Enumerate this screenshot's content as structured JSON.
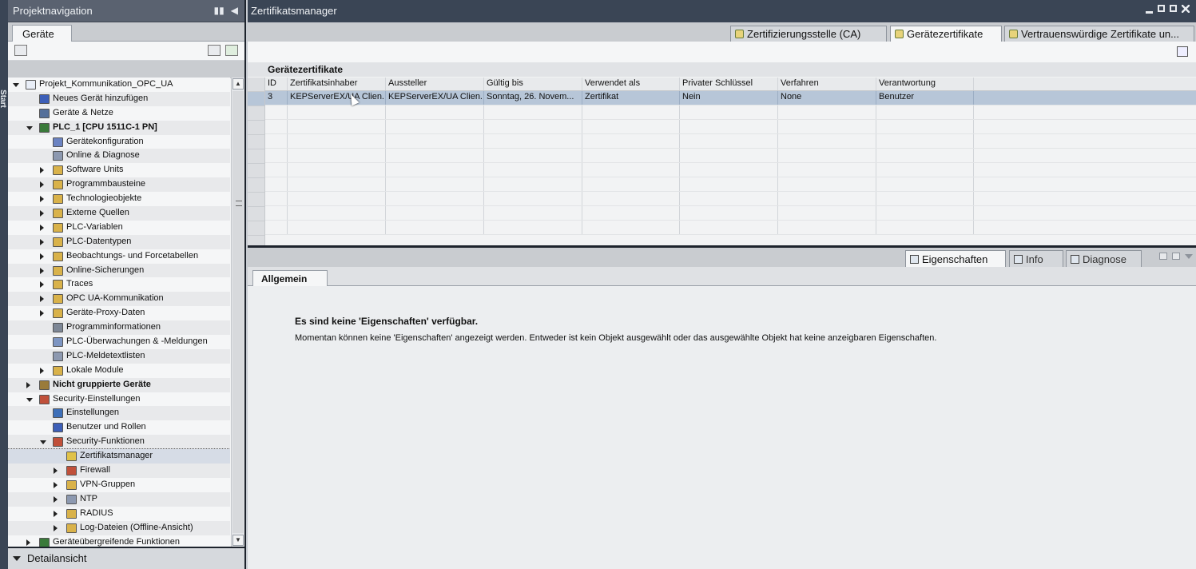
{
  "left_strip": {
    "label": "Start"
  },
  "nav": {
    "title": "Projektnavigation",
    "tab": "Geräte",
    "detail": "Detailansicht"
  },
  "tree": [
    {
      "label": "Projekt_Kommunikation_OPC_UA",
      "indent": 0,
      "arrow": "down",
      "icon": "project-icon",
      "color": "#e9eef7",
      "bold": false
    },
    {
      "label": "Neues Gerät hinzufügen",
      "indent": 1,
      "arrow": "",
      "icon": "add-device-icon",
      "color": "#3d5fb8",
      "bold": false
    },
    {
      "label": "Geräte & Netze",
      "indent": 1,
      "arrow": "",
      "icon": "network-icon",
      "color": "#55709a",
      "bold": false
    },
    {
      "label": "PLC_1 [CPU 1511C-1 PN]",
      "indent": 1,
      "arrow": "down",
      "icon": "plc-icon",
      "color": "#3a7a3a",
      "bold": true
    },
    {
      "label": "Gerätekonfiguration",
      "indent": 2,
      "arrow": "",
      "icon": "device-config-icon",
      "color": "#6b83c2",
      "bold": false
    },
    {
      "label": "Online & Diagnose",
      "indent": 2,
      "arrow": "",
      "icon": "diagnose-icon",
      "color": "#8d99b0",
      "bold": false
    },
    {
      "label": "Software Units",
      "indent": 2,
      "arrow": "right",
      "icon": "software-units-icon",
      "color": "#d9b24a",
      "bold": false
    },
    {
      "label": "Programmbausteine",
      "indent": 2,
      "arrow": "right",
      "icon": "folder-icon",
      "color": "#d9b24a",
      "bold": false
    },
    {
      "label": "Technologieobjekte",
      "indent": 2,
      "arrow": "right",
      "icon": "technology-icon",
      "color": "#d9b24a",
      "bold": false
    },
    {
      "label": "Externe Quellen",
      "indent": 2,
      "arrow": "right",
      "icon": "folder-icon",
      "color": "#d9b24a",
      "bold": false
    },
    {
      "label": "PLC-Variablen",
      "indent": 2,
      "arrow": "right",
      "icon": "folder-icon",
      "color": "#d9b24a",
      "bold": false
    },
    {
      "label": "PLC-Datentypen",
      "indent": 2,
      "arrow": "right",
      "icon": "folder-icon",
      "color": "#d9b24a",
      "bold": false
    },
    {
      "label": "Beobachtungs- und Forcetabellen",
      "indent": 2,
      "arrow": "right",
      "icon": "folder-icon",
      "color": "#d9b24a",
      "bold": false
    },
    {
      "label": "Online-Sicherungen",
      "indent": 2,
      "arrow": "right",
      "icon": "folder-icon",
      "color": "#d9b24a",
      "bold": false
    },
    {
      "label": "Traces",
      "indent": 2,
      "arrow": "right",
      "icon": "folder-icon",
      "color": "#d9b24a",
      "bold": false
    },
    {
      "label": "OPC UA-Kommunikation",
      "indent": 2,
      "arrow": "right",
      "icon": "folder-icon",
      "color": "#d9b24a",
      "bold": false
    },
    {
      "label": "Geräte-Proxy-Daten",
      "indent": 2,
      "arrow": "right",
      "icon": "folder-icon",
      "color": "#d9b24a",
      "bold": false
    },
    {
      "label": "Programminformationen",
      "indent": 2,
      "arrow": "",
      "icon": "program-info-icon",
      "color": "#7d8796",
      "bold": false
    },
    {
      "label": "PLC-Überwachungen & -Meldungen",
      "indent": 2,
      "arrow": "",
      "icon": "alarm-icon",
      "color": "#7d95c2",
      "bold": false
    },
    {
      "label": "PLC-Meldetextlisten",
      "indent": 2,
      "arrow": "",
      "icon": "textlist-icon",
      "color": "#8d99b0",
      "bold": false
    },
    {
      "label": "Lokale Module",
      "indent": 2,
      "arrow": "right",
      "icon": "folder-icon",
      "color": "#d9b24a",
      "bold": false
    },
    {
      "label": "Nicht gruppierte Geräte",
      "indent": 1,
      "arrow": "right",
      "icon": "devices-icon",
      "color": "#9a7b3a",
      "bold": true
    },
    {
      "label": "Security-Einstellungen",
      "indent": 1,
      "arrow": "down",
      "icon": "security-icon",
      "color": "#c0503a",
      "bold": false
    },
    {
      "label": "Einstellungen",
      "indent": 2,
      "arrow": "",
      "icon": "settings-icon",
      "color": "#3d6fb8",
      "bold": false
    },
    {
      "label": "Benutzer und Rollen",
      "indent": 2,
      "arrow": "",
      "icon": "users-icon",
      "color": "#3d5fb8",
      "bold": false
    },
    {
      "label": "Security-Funktionen",
      "indent": 2,
      "arrow": "down",
      "icon": "firewall-icon",
      "color": "#c0503a",
      "bold": false
    },
    {
      "label": "Zertifikatsmanager",
      "indent": 3,
      "arrow": "",
      "icon": "certificate-icon",
      "color": "#e0c24a",
      "bold": false,
      "selected": true
    },
    {
      "label": "Firewall",
      "indent": 3,
      "arrow": "right",
      "icon": "firewall-icon",
      "color": "#c0503a",
      "bold": false
    },
    {
      "label": "VPN-Gruppen",
      "indent": 3,
      "arrow": "right",
      "icon": "vpn-icon",
      "color": "#d9b24a",
      "bold": false
    },
    {
      "label": "NTP",
      "indent": 3,
      "arrow": "right",
      "icon": "ntp-icon",
      "color": "#8d99b0",
      "bold": false
    },
    {
      "label": "RADIUS",
      "indent": 3,
      "arrow": "right",
      "icon": "folder-icon",
      "color": "#d9b24a",
      "bold": false
    },
    {
      "label": "Log-Dateien (Offline-Ansicht)",
      "indent": 3,
      "arrow": "right",
      "icon": "log-icon",
      "color": "#d9b24a",
      "bold": false
    },
    {
      "label": "Geräteübergreifende Funktionen",
      "indent": 1,
      "arrow": "right",
      "icon": "cross-device-icon",
      "color": "#3a7a3a",
      "bold": false
    }
  ],
  "main": {
    "title": "Zertifikatsmanager",
    "tabs": [
      {
        "label": "Zertifizierungsstelle (CA)",
        "active": false
      },
      {
        "label": "Gerätezertifikate",
        "active": true
      },
      {
        "label": "Vertrauenswürdige Zertifikate un...",
        "active": false
      }
    ],
    "grid_title": "Gerätezertifikate",
    "columns": [
      "ID",
      "Zertifikatsinhaber",
      "Aussteller",
      "Gültig bis",
      "Verwendet als",
      "Privater Schlüssel",
      "Verfahren",
      "Verantwortung"
    ],
    "rows": [
      [
        "3",
        "KEPServerEX/UA Clien...",
        "KEPServerEX/UA Clien...",
        "Sonntag, 26. Novem...",
        "Zertifikat",
        "Nein",
        "None",
        "Benutzer"
      ]
    ]
  },
  "inspector": {
    "tabs": [
      {
        "label": "Eigenschaften",
        "active": true,
        "icon": "properties-icon"
      },
      {
        "label": "Info",
        "active": false,
        "icon": "info-icon"
      },
      {
        "label": "Diagnose",
        "active": false,
        "icon": "diagnose-icon"
      }
    ],
    "subtab": "Allgemein",
    "msg_title": "Es sind keine 'Eigenschaften' verfügbar.",
    "msg_text": "Momentan können keine 'Eigenschaften' angezeigt werden. Entweder ist kein Objekt ausgewählt oder das ausgewählte Objekt hat keine anzeigbaren Eigenschaften."
  }
}
